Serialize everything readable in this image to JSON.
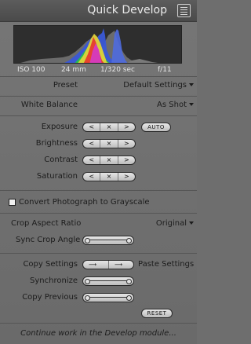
{
  "header": {
    "title": "Quick Develop"
  },
  "histogram": {
    "info": {
      "iso": "ISO 100",
      "focal": "24 mm",
      "shutter": "1/320 sec",
      "aperture": "f/11"
    }
  },
  "preset": {
    "label": "Preset",
    "value": "Default Settings"
  },
  "white_balance": {
    "label": "White Balance",
    "value": "As Shot"
  },
  "tone": {
    "rows": [
      {
        "label": "Exposure",
        "has_auto": true
      },
      {
        "label": "Brightness"
      },
      {
        "label": "Contrast"
      },
      {
        "label": "Saturation"
      }
    ],
    "stepper": {
      "left": "<",
      "mid": "×",
      "right": ">"
    },
    "auto_label": "AUTO"
  },
  "grayscale": {
    "label": "Convert Photograph to Grayscale",
    "checked": false
  },
  "crop": {
    "aspect_label": "Crop Aspect Ratio",
    "aspect_value": "Original",
    "angle_label": "Sync Crop Angle"
  },
  "copy": {
    "copy_label": "Copy Settings",
    "paste_label": "Paste Settings",
    "synchronize_label": "Synchronize",
    "copy_previous_label": "Copy Previous",
    "reset_label": "RESET"
  },
  "footer": {
    "text": "Continue work in the Develop module..."
  }
}
